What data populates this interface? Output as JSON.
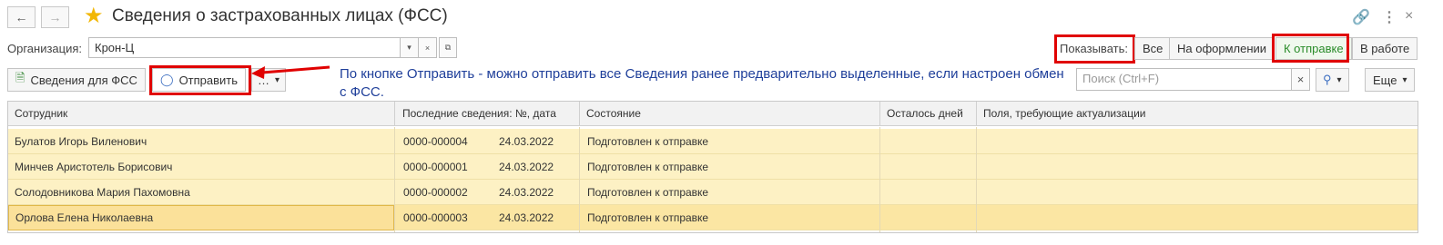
{
  "window": {
    "title": "Сведения о застрахованных лицах (ФСС)",
    "back_icon": "arrow-left-icon",
    "forward_icon": "arrow-right-icon",
    "favorite_icon": "star-icon",
    "link_icon": "link-icon",
    "menu_icon": "kebab-menu-icon",
    "favorite_color": "#f2b705"
  },
  "org": {
    "label": "Организация:",
    "value": "Крон-Ц",
    "dropdown_glyph": "▾",
    "open_glyph": "⧉"
  },
  "filter": {
    "label": "Показывать:",
    "options": [
      "Все",
      "На оформлении",
      "К отправке",
      "В работе"
    ],
    "selected": "К отправке",
    "selected_color": "#2a8c2a"
  },
  "toolbar": {
    "fss_button": "Сведения для ФСС",
    "send_button": "Отправить",
    "more_glyph": "…",
    "dropdown_glyph": "▾",
    "search_placeholder": "Поиск (Ctrl+F)",
    "clear_glyph": "×",
    "search_icon_glyph": "🔍",
    "more_button": "Еще"
  },
  "annotation": {
    "text": "По кнопке Отправить - можно отправить все Сведения ранее предварительно выделенные, если настроен обмен с ФСС.",
    "color": "#1f3f9a",
    "highlight_color": "#e00000"
  },
  "table": {
    "columns": [
      "Сотрудник",
      "Последние сведения: №, дата",
      "Состояние",
      "Осталось дней",
      "Поля, требующие актуализации"
    ],
    "rows": [
      {
        "employee": "Булатов Игорь Виленович",
        "number": "0000-000004",
        "date": "24.03.2022",
        "state": "Подготовлен к отправке",
        "days": "",
        "fields": ""
      },
      {
        "employee": "Минчев Аристотель Борисович",
        "number": "0000-000001",
        "date": "24.03.2022",
        "state": "Подготовлен к отправке",
        "days": "",
        "fields": ""
      },
      {
        "employee": "Солодовникова Мария Пахомовна",
        "number": "0000-000002",
        "date": "24.03.2022",
        "state": "Подготовлен к отправке",
        "days": "",
        "fields": ""
      },
      {
        "employee": "Орлова Елена Николаевна",
        "number": "0000-000003",
        "date": "24.03.2022",
        "state": "Подготовлен к отправке",
        "days": "",
        "fields": ""
      }
    ],
    "row_color": "#fdf1c4",
    "selected_row": 3
  }
}
